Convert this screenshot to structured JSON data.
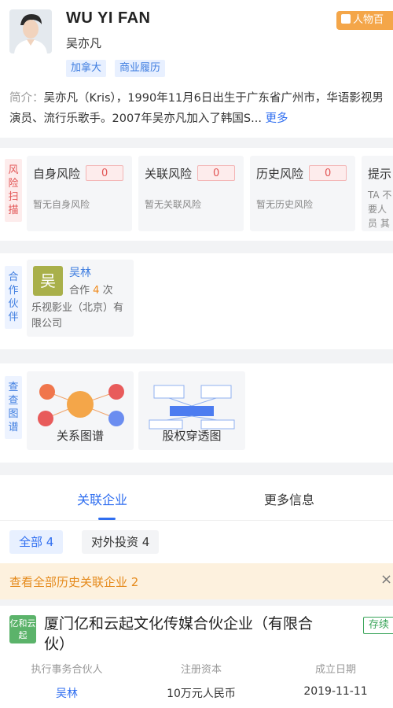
{
  "profile": {
    "name_en": "WU YI FAN",
    "name_cn": "吴亦凡",
    "tags": [
      "加拿大",
      "商业履历"
    ],
    "baike": "人物百",
    "intro_label": "简介：",
    "intro_text": "吴亦凡（Kris），1990年11月6日出生于广东省广州市，华语影视男演员、流行乐歌手。2007年吴亦凡加入了韩国S...",
    "intro_more": "更多"
  },
  "risk": {
    "label": "风险扫描",
    "cards": [
      {
        "title": "自身风险",
        "count": "0",
        "desc": "暂无自身风险"
      },
      {
        "title": "关联风险",
        "count": "0",
        "desc": "暂无关联风险"
      },
      {
        "title": "历史风险",
        "count": "0",
        "desc": "暂无历史风险"
      },
      {
        "title": "提示",
        "desc": "TA 不 要人员 其他"
      }
    ]
  },
  "partners": {
    "label": "合作伙伴",
    "items": [
      {
        "avatar_char": "吴",
        "name": "吴林",
        "count_prefix": "合作",
        "count": "4",
        "count_suffix": "次",
        "company": "乐视影业（北京）有限公司"
      }
    ]
  },
  "tools": {
    "label": "查查图谱",
    "items": [
      {
        "label": "关系图谱",
        "icon": "relation-graph-icon"
      },
      {
        "label": "股权穿透图",
        "icon": "equity-chart-icon"
      }
    ]
  },
  "tabs": [
    "关联企业",
    "更多信息"
  ],
  "filters": [
    {
      "label": "全部",
      "count": "4"
    },
    {
      "label": "对外投资",
      "count": "4"
    }
  ],
  "history": {
    "text": "查看全部历史关联企业 2",
    "close": "×"
  },
  "company": {
    "logo": "亿和云起",
    "name": "厦门亿和云起文化传媒合伙企业（有限合伙）",
    "status": "存续",
    "fields": [
      {
        "key": "执行事务合伙人",
        "value": "吴林"
      },
      {
        "key": "注册资本",
        "value": "10万元人民币"
      },
      {
        "key": "成立日期",
        "value": "2019-11-11"
      }
    ]
  },
  "colors": {
    "brand_blue": "#2f6ef0",
    "risk_red": "#e25555",
    "orange": "#f4a649",
    "status_green": "#3aa55a"
  }
}
